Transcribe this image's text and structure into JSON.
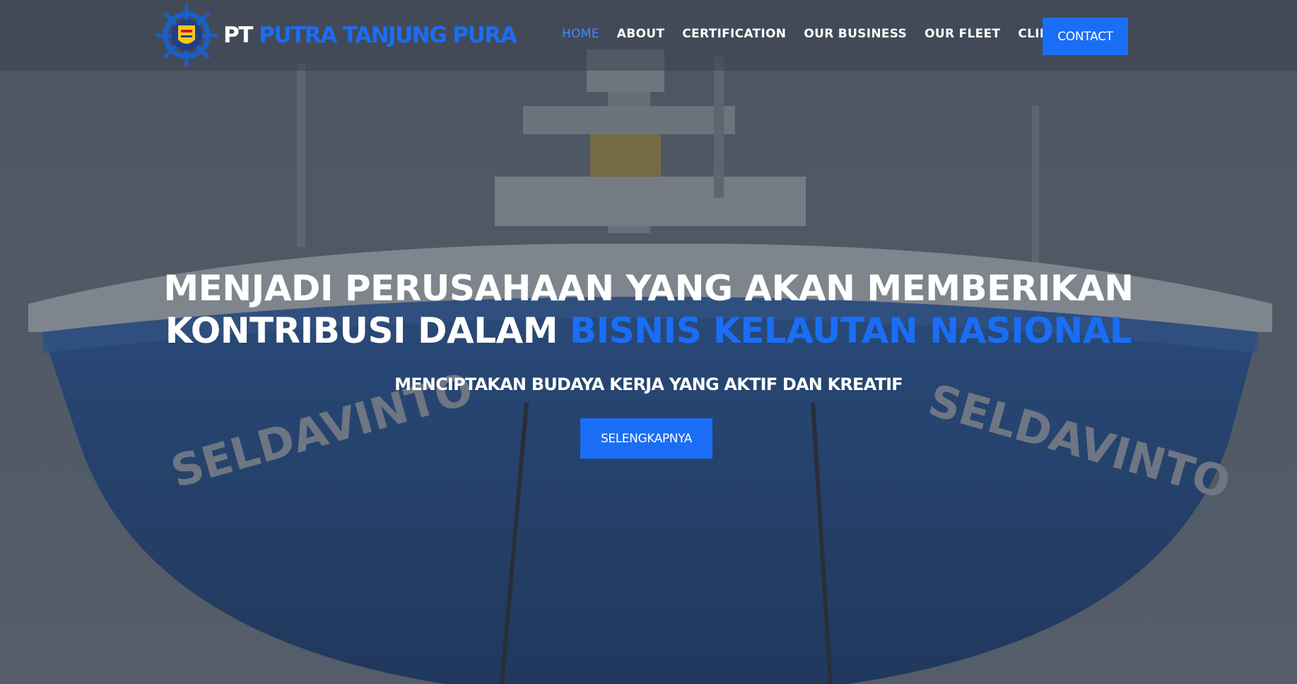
{
  "header": {
    "brand_prefix": "PT",
    "brand_name": "PUTRA TANJUNG PURA",
    "logo_icon": "ship-wheel-emblem-icon"
  },
  "nav": {
    "items": [
      {
        "label": "HOME",
        "active": true
      },
      {
        "label": "ABOUT",
        "active": false
      },
      {
        "label": "CERTIFICATION",
        "active": false
      },
      {
        "label": "OUR BUSINESS",
        "active": false
      },
      {
        "label": "OUR FLEET",
        "active": false
      },
      {
        "label": "CLIENT",
        "active": false
      }
    ],
    "contact_label": "CONTACT"
  },
  "hero": {
    "headline_line1": "MENJADI PERUSAHAAN YANG AKAN MEMBERIKAN",
    "headline_line2_prefix": "KONTRIBUSI DALAM",
    "headline_line2_accent": "BISNIS KELAUTAN NASIONAL",
    "subheadline": "MENCIPTAKAN BUDAYA KERJA YANG AKTIF DAN KREATIF",
    "cta_label": "SELENGKAPNYA",
    "ship_name_left": "SELDAVINTO",
    "ship_name_right": "SELDAVINTO"
  },
  "colors": {
    "accent": "#1a6ef5",
    "active_nav": "#3d8bff",
    "text": "#ffffff",
    "header_bg": "#4a5260"
  }
}
